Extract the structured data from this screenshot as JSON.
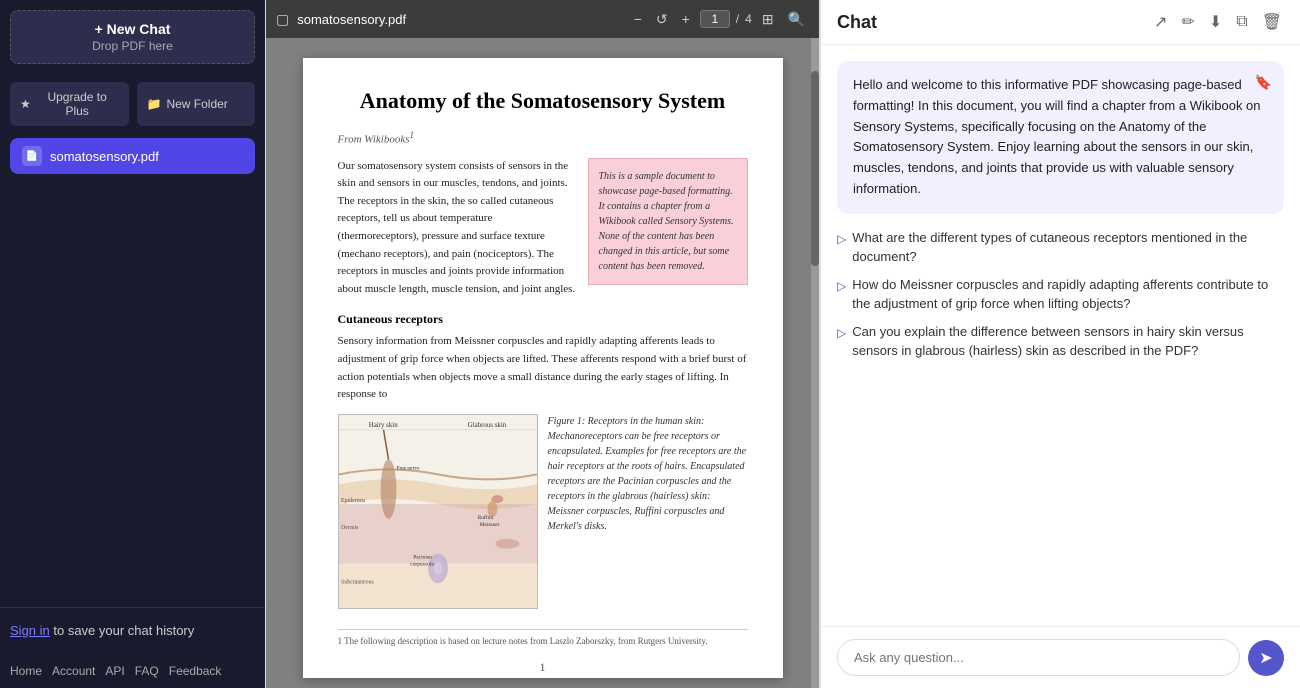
{
  "sidebar": {
    "new_chat_label": "+ New Chat",
    "drop_pdf_label": "Drop PDF here",
    "upgrade_label": "Upgrade to Plus",
    "new_folder_label": "New Folder",
    "pdf_file": "somatosensory.pdf",
    "sign_in_text": "Sign in",
    "sign_in_suffix": " to save your chat history",
    "links": [
      "Home",
      "Account",
      "API",
      "FAQ",
      "Feedback"
    ]
  },
  "pdf_toolbar": {
    "filename": "somatosensory.pdf",
    "page_current": "1",
    "page_separator": "/",
    "page_total": "4"
  },
  "pdf_content": {
    "title": "Anatomy of the Somatosensory System",
    "from_wikis": "From Wikibooks",
    "superscript": "1",
    "body_para1": "Our somatosensory system consists of sensors in the skin and sensors in our muscles, tendons, and joints. The receptors in the skin, the so called cutaneous receptors, tell us about temperature (thermoreceptors), pressure and surface texture (mechano receptors), and pain (nociceptors). The receptors in muscles and joints provide information about muscle length, muscle tension, and joint angles.",
    "pink_box_text": "This is a sample document to showcase page-based formatting. It contains a chapter from a Wikibook called Sensory Systems. None of the content has been changed in this article, but some content has been removed.",
    "section_cutaneous": "Cutaneous receptors",
    "body_para2": "Sensory information from Meissner corpuscles and rapidly adapting afferents leads to adjustment of grip force when objects are lifted. These afferents respond with a brief burst of action potentials when objects move a small distance during the early stages of lifting. In response to",
    "figure_caption": "Figure 1: Receptors in the human skin: Mechanoreceptors can be free receptors or encapsulated. Examples for free receptors are the hair receptors at the roots of hairs. Encapsulated receptors are the Pacinian corpuscles and the receptors in the glabrous (hairless) skin: Meissner corpuscles, Ruffini corpuscles and Merkel's disks.",
    "footnote": "1 The following description is based on lecture notes from Laszlo Zaborszky, from Rutgers University.",
    "page_number": "1"
  },
  "chat": {
    "title": "Chat",
    "welcome_message": "Hello and welcome to this informative PDF showcasing page-based formatting! In this document, you will find a chapter from a Wikibook on Sensory Systems, specifically focusing on the Anatomy of the Somatosensory System. Enjoy learning about the sensors in our skin, muscles, tendons, and joints that provide us with valuable sensory information.",
    "questions": [
      "What are the different types of cutaneous receptors mentioned in the document?",
      "How do Meissner corpuscles and rapidly adapting afferents contribute to the adjustment of grip force when lifting objects?",
      "Can you explain the difference between sensors in hairy skin versus sensors in glabrous (hairless) skin as described in the PDF?"
    ],
    "input_placeholder": "Ask any question...",
    "send_icon": "➤",
    "actions": {
      "export": "↗",
      "edit": "✏",
      "download": "⬇",
      "copy": "⧉",
      "clear": "🗑"
    }
  }
}
